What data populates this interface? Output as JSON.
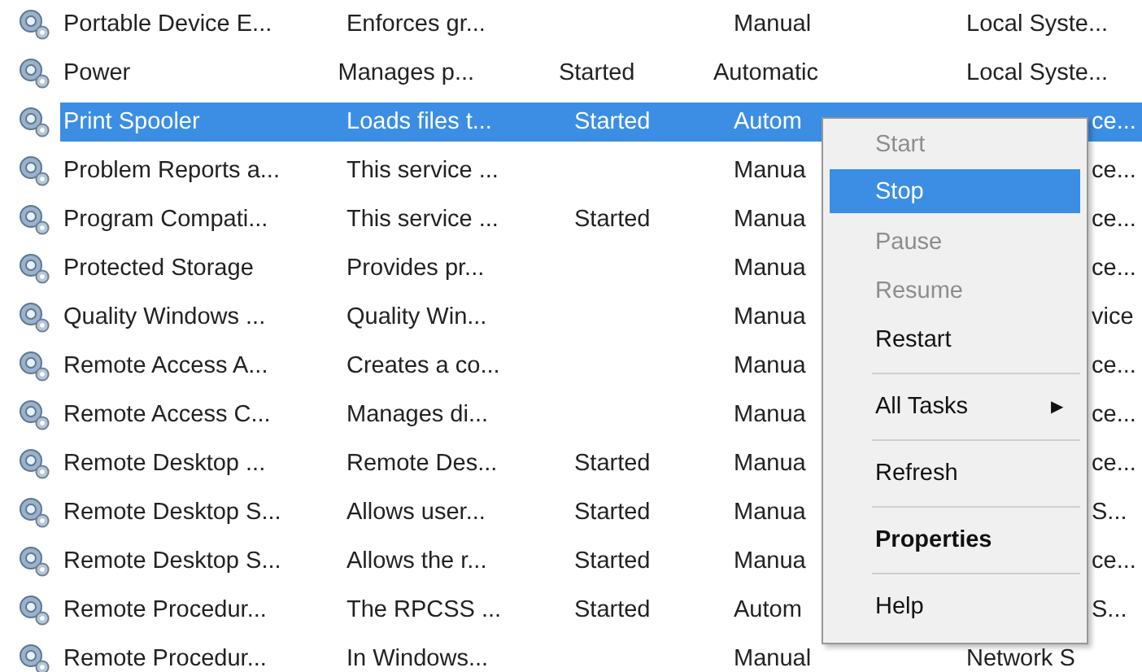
{
  "services": [
    {
      "name": "Portable Device E...",
      "description": "Enforces gr...",
      "startup": "Manual",
      "logon": "Local Syste...",
      "selected": false,
      "covered": false
    },
    {
      "name": "Power",
      "description": "Manages p...",
      "status": "Started",
      "startup": "Automatic",
      "logon": "Local Syste...",
      "selected": false,
      "covered": false
    },
    {
      "name": "Print Spooler",
      "description": "Loads files t...",
      "status": "Started",
      "startup": "Autom",
      "logon": "ce...",
      "selected": true,
      "covered": true
    },
    {
      "name": "Problem Reports a...",
      "description": "This service ...",
      "startup": "Manua",
      "logon": "ce...",
      "selected": false,
      "covered": true
    },
    {
      "name": "Program Compati...",
      "description": "This service ...",
      "status": "Started",
      "startup": "Manua",
      "logon": "ce...",
      "selected": false,
      "covered": true
    },
    {
      "name": "Protected Storage",
      "description": "Provides pr...",
      "startup": "Manua",
      "logon": "ce...",
      "selected": false,
      "covered": true
    },
    {
      "name": "Quality Windows ...",
      "description": "Quality Win...",
      "startup": "Manua",
      "logon": "vice",
      "selected": false,
      "covered": true
    },
    {
      "name": "Remote Access A...",
      "description": "Creates a co...",
      "startup": "Manua",
      "logon": "ce...",
      "selected": false,
      "covered": true
    },
    {
      "name": "Remote Access C...",
      "description": "Manages di...",
      "startup": "Manua",
      "logon": "ce...",
      "selected": false,
      "covered": true
    },
    {
      "name": "Remote Desktop ...",
      "description": "Remote Des...",
      "status": "Started",
      "startup": "Manua",
      "logon": "ce...",
      "selected": false,
      "covered": true
    },
    {
      "name": "Remote Desktop S...",
      "description": "Allows user...",
      "status": "Started",
      "startup": "Manua",
      "logon": "S...",
      "selected": false,
      "covered": true
    },
    {
      "name": "Remote Desktop S...",
      "description": "Allows the r...",
      "status": "Started",
      "startup": "Manua",
      "logon": "ce...",
      "selected": false,
      "covered": true
    },
    {
      "name": "Remote Procedur...",
      "description": "The RPCSS ...",
      "status": "Started",
      "startup": "Autom",
      "logon": "S...",
      "selected": false,
      "covered": true
    },
    {
      "name": "Remote Procedur...",
      "description": "In Windows...",
      "startup": "Manual",
      "logon": "Network S",
      "selected": false,
      "covered": false
    }
  ],
  "context_menu": [
    {
      "kind": "item",
      "label": "Start",
      "disabled": true,
      "selected": false
    },
    {
      "kind": "item",
      "label": "Stop",
      "disabled": false,
      "selected": true
    },
    {
      "kind": "item",
      "label": "Pause",
      "disabled": true,
      "selected": false
    },
    {
      "kind": "item",
      "label": "Resume",
      "disabled": true,
      "selected": false
    },
    {
      "kind": "item",
      "label": "Restart",
      "disabled": false,
      "selected": false
    },
    {
      "kind": "separator"
    },
    {
      "kind": "submenu",
      "label": "All Tasks",
      "arrow": "▶",
      "disabled": false,
      "selected": false
    },
    {
      "kind": "separator"
    },
    {
      "kind": "item",
      "label": "Refresh",
      "disabled": false,
      "selected": false
    },
    {
      "kind": "separator"
    },
    {
      "kind": "default",
      "label": "Properties",
      "disabled": false,
      "selected": false
    },
    {
      "kind": "separator"
    },
    {
      "kind": "item",
      "label": "Help",
      "disabled": false,
      "selected": false
    }
  ]
}
